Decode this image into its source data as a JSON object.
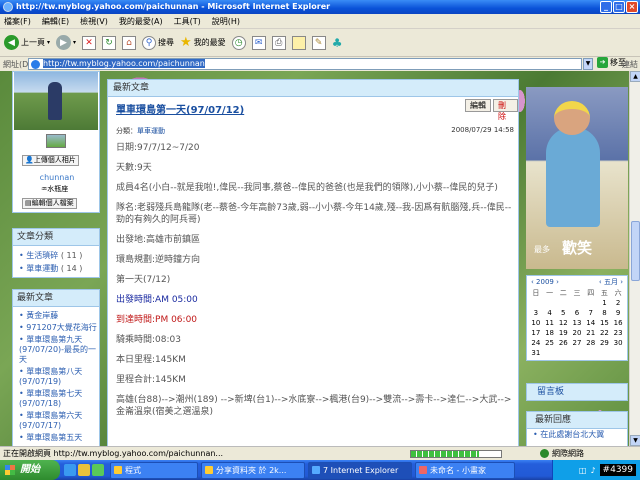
{
  "window": {
    "title": "http://tw.myblog.yahoo.com/paichunnan - Microsoft Internet Explorer"
  },
  "menu": [
    "檔案(F)",
    "編輯(E)",
    "檢視(V)",
    "我的最愛(A)",
    "工具(T)",
    "說明(H)"
  ],
  "toolbar": {
    "back": "上一頁",
    "search": "搜尋",
    "favorites": "我的最愛"
  },
  "address": {
    "label": "網址(D)",
    "url": "http://tw.myblog.yahoo.com/paichunnan",
    "go": "移至",
    "links": "連結"
  },
  "profile": {
    "upload_btn": "上傳個人相片",
    "name": "chunnan",
    "role": "水瓶座",
    "edit_btn": "編輯個人檔案"
  },
  "categories": {
    "title": "文章分類",
    "items": [
      {
        "name": "生活瑣碎",
        "count": "( 11 )"
      },
      {
        "name": "單車運動",
        "count": "( 14 )"
      }
    ]
  },
  "recent": {
    "title": "最新文章",
    "items": [
      "黃金岸藤",
      "971207大覺花海行",
      "單車環島第九天(97/07/20)-最長的一天",
      "單車環島第八天(97/07/19)",
      "單車環島第七天(97/07/18)",
      "單車環島第六天(97/07/17)",
      "單車環島第五天"
    ]
  },
  "main": {
    "header": "最新文章",
    "title": "單車環島第一天(97/07/12)",
    "edit_btn": "編輯",
    "delete_btn": "刪除",
    "category_label": "分類：",
    "category": "單車運動",
    "date": "2008/07/29 14:58",
    "body": [
      {
        "text": "日期:97/7/12~7/20",
        "style": "normal"
      },
      {
        "text": "天數:9天",
        "style": "normal"
      },
      {
        "text": "成員4名(小白--就是我啦!,偉民--我同事,蔡爸--偉民的爸爸(也是我們的領隊),小小蔡--偉民的兒子)",
        "style": "normal"
      },
      {
        "text": "隊名:老弱殘兵島龍隊(老--蔡爸-今年高齡73歲,弱--小小蔡-今年14歲,殘--我-因爲有骯腦殘,兵--偉民--勁的有夠久的阿兵哥)",
        "style": "normal"
      },
      {
        "text": "出發地:高雄市前鎮區",
        "style": "normal"
      },
      {
        "text": "環島規劃:逆時鐘方向",
        "style": "normal"
      },
      {
        "text": "第一天(7/12)",
        "style": "normal"
      },
      {
        "text": "出發時間:AM 05:00",
        "style": "blue"
      },
      {
        "text": "到達時間:PM 06:00",
        "style": "red"
      },
      {
        "text": "騎乘時間:08:03",
        "style": "normal"
      },
      {
        "text": "本日里程:145KM",
        "style": "normal"
      },
      {
        "text": "里程合計:145KM",
        "style": "normal"
      },
      {
        "text": "高雄(台88)-->潮州(189) -->新埤(台1)-->水底寮-->楓港(台9)-->雙流-->壽卡-->達仁-->大武-->金崙溫泉(宿美之選溫泉)",
        "style": "normal"
      }
    ]
  },
  "side": {
    "banner_big": "歡笑",
    "banner_small": "最多",
    "calendar": {
      "year": "2009",
      "month": "五月",
      "days_header": [
        "日",
        "一",
        "二",
        "三",
        "四",
        "五",
        "六"
      ],
      "days": [
        "",
        "",
        "",
        "",
        "",
        "1",
        "2",
        "3",
        "4",
        "5",
        "6",
        "7",
        "8",
        "9",
        "10",
        "11",
        "12",
        "13",
        "14",
        "15",
        "16",
        "17",
        "18",
        "19",
        "20",
        "21",
        "22",
        "23",
        "24",
        "25",
        "26",
        "27",
        "28",
        "29",
        "30",
        "31",
        "",
        "",
        "",
        "",
        "",
        ""
      ]
    },
    "guestbook": "留言板",
    "new_reply_title": "最新回應",
    "new_reply_item": "在此處謝台北大翼"
  },
  "status": {
    "text": "正在開啟網頁 http://tw.myblog.yahoo.com/paichunnan...",
    "progress": 0.75,
    "zone": "網際網路"
  },
  "taskbar": {
    "start": "開始",
    "buttons": [
      "程式",
      "分享資料夾 於 2k...",
      "7 Internet Explorer",
      "未命名 - 小畫家"
    ],
    "clock": "#4399"
  },
  "colors": {
    "accent": "#1a4fa0",
    "box_header": "#d4ecfa",
    "border": "#9ec6e8"
  }
}
